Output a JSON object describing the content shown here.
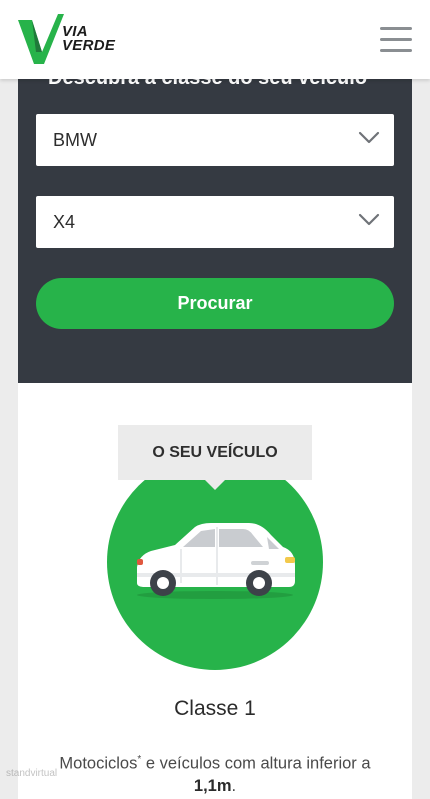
{
  "brand": {
    "line1": "VIA",
    "line2": "VERDE"
  },
  "search": {
    "heading": "Descubra a classe do seu veículo",
    "make_value": "BMW",
    "model_value": "X4",
    "button_label": "Procurar"
  },
  "vehicle": {
    "tag_label": "O SEU VEÍCULO",
    "class_label": "Classe 1",
    "desc_prefix": "Motociclos",
    "desc_asterisk": "*",
    "desc_middle": " e veículos com altura inferior a ",
    "desc_height": "1,1m",
    "desc_suffix": "."
  },
  "watermark": "standvirtual",
  "colors": {
    "accent_green": "#27b34a",
    "dark_panel": "#353a42",
    "logo_dark": "#1f7a3a"
  },
  "icons": [
    "via-verde-logo",
    "hamburger-menu-icon",
    "chevron-down-icon",
    "car-icon"
  ]
}
